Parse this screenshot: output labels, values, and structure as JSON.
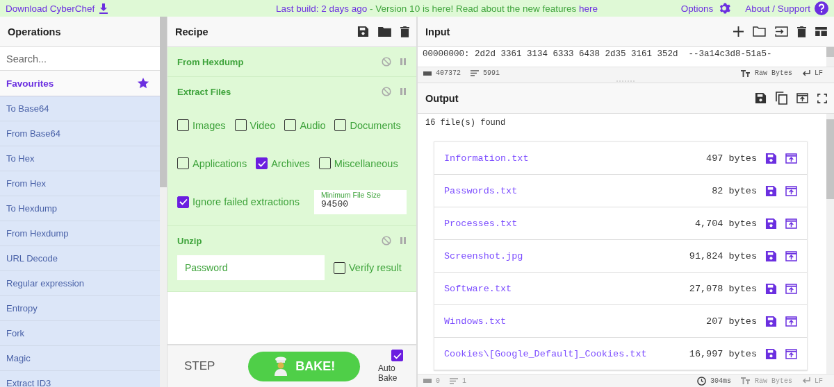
{
  "top_bar": {
    "download": "Download CyberChef",
    "build_prefix": "Last build: 2 days ago",
    "build_text": " - Version 10 is here! Read about the new features ",
    "build_link": "here",
    "options": "Options",
    "about": "About / Support"
  },
  "operations": {
    "title": "Operations",
    "search": {
      "placeholder": "Search..."
    },
    "favourites": "Favourites",
    "items": [
      "To Base64",
      "From Base64",
      "To Hex",
      "From Hex",
      "To Hexdump",
      "From Hexdump",
      "URL Decode",
      "Regular expression",
      "Entropy",
      "Fork",
      "Magic",
      "Extract ID3"
    ]
  },
  "recipe": {
    "title": "Recipe",
    "steps": [
      {
        "name": "From Hexdump",
        "disabled": false,
        "paused": false
      },
      {
        "name": "Extract Files",
        "disabled": false,
        "paused": false,
        "checkbox_rows": [
          [
            {
              "label": "Images",
              "checked": false
            },
            {
              "label": "Video",
              "checked": false
            },
            {
              "label": "Audio",
              "checked": false
            },
            {
              "label": "Documents",
              "checked": false
            }
          ],
          [
            {
              "label": "Applications",
              "checked": false
            },
            {
              "label": "Archives",
              "checked": true
            },
            {
              "label": "Miscellaneous",
              "checked": false
            }
          ]
        ],
        "ignore_failed": {
          "label": "Ignore failed extractions",
          "checked": true
        },
        "min_size": {
          "label": "Minimum File Size",
          "value": "94500"
        }
      },
      {
        "name": "Unzip",
        "disabled": false,
        "paused": false,
        "password": {
          "placeholder": "Password"
        },
        "verify": {
          "label": "Verify result",
          "checked": false
        }
      }
    ],
    "step_button": "STEP",
    "bake_button": "BAKE!",
    "auto_bake": {
      "label": "Auto Bake",
      "checked": true
    }
  },
  "input": {
    "title": "Input",
    "text": "00000000: 2d2d 3361 3134 6333 6438 2d35 3161 352d  --3a14c3d8-51a5-",
    "length": "407372",
    "lines": "5991",
    "format": "Raw Bytes",
    "eol": "LF"
  },
  "output": {
    "title": "Output",
    "summary": "16 file(s) found",
    "files": [
      {
        "name": "Information.txt",
        "size": "497 bytes"
      },
      {
        "name": "Passwords.txt",
        "size": "82 bytes"
      },
      {
        "name": "Processes.txt",
        "size": "4,704 bytes"
      },
      {
        "name": "Screenshot.jpg",
        "size": "91,824 bytes"
      },
      {
        "name": "Software.txt",
        "size": "27,078 bytes"
      },
      {
        "name": "Windows.txt",
        "size": "207 bytes"
      },
      {
        "name": "Cookies\\[Google_Default]_Cookies.txt",
        "size": "16,997 bytes"
      }
    ],
    "length": "0",
    "lines": "1",
    "time": "304ms",
    "format": "Raw Bytes",
    "eol": "LF"
  }
}
